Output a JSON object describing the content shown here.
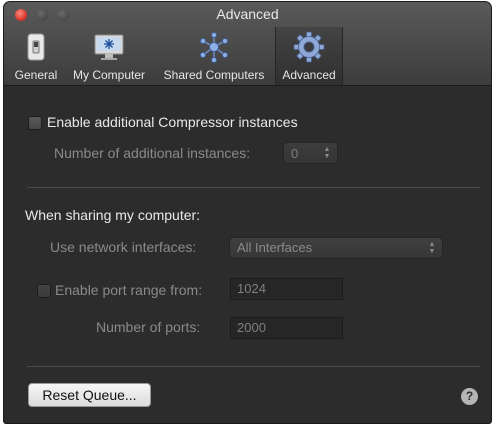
{
  "window": {
    "title": "Advanced"
  },
  "tabs": [
    {
      "label": "General",
      "icon": "switch-icon"
    },
    {
      "label": "My Computer",
      "icon": "monitor-icon"
    },
    {
      "label": "Shared Computers",
      "icon": "network-nodes-icon"
    },
    {
      "label": "Advanced",
      "icon": "gear-icon",
      "active": true
    }
  ],
  "advanced": {
    "enable_instances_label": "Enable additional Compressor instances",
    "enable_instances_checked": false,
    "instances_label": "Number of additional instances:",
    "instances_value": "0",
    "sharing_heading": "When sharing my computer:",
    "network_label": "Use network interfaces:",
    "network_value": "All Interfaces",
    "port_range_label": "Enable port range from:",
    "port_range_checked": false,
    "port_start_value": "1024",
    "ports_count_label": "Number of ports:",
    "ports_count_value": "2000",
    "reset_button": "Reset Queue...",
    "help_glyph": "?"
  },
  "colors": {
    "close": "#d9342b",
    "background": "#2c2c2c",
    "text": "#e9e9e9",
    "dim_text": "#8a8a8a"
  }
}
